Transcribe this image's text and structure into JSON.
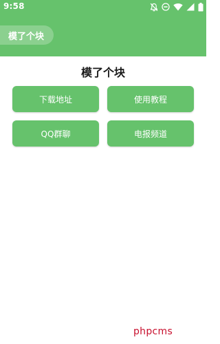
{
  "status_bar": {
    "time": "9:58",
    "icons": [
      "notifications-off-icon",
      "do-not-disturb-icon",
      "wifi-icon",
      "signal-icon",
      "battery-icon"
    ]
  },
  "app_bar": {
    "title": "模了个块"
  },
  "main": {
    "heading": "模了个块",
    "buttons": [
      {
        "label": "下载地址"
      },
      {
        "label": "使用教程"
      },
      {
        "label": "QQ群聊"
      },
      {
        "label": "电报频道"
      }
    ]
  },
  "watermark": "phpcms",
  "colors": {
    "primary": "#66c26c",
    "pill": "#8bd08f",
    "watermark": "#c8102e"
  }
}
